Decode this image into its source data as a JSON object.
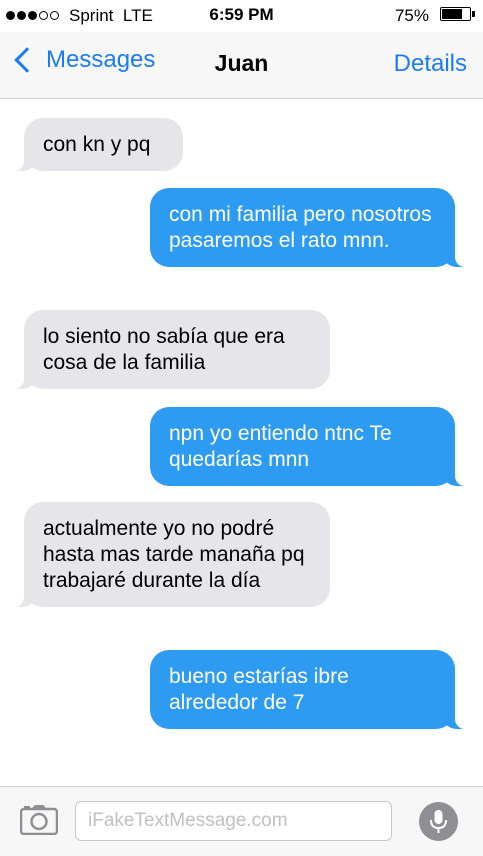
{
  "status_bar": {
    "signal_filled": 3,
    "signal_total": 5,
    "carrier": "Sprint",
    "network": "LTE",
    "time": "6:59 PM",
    "battery_text": "75%",
    "battery_level": 0.75
  },
  "nav": {
    "back_label": "Messages",
    "title": "Juan",
    "details_label": "Details"
  },
  "messages": [
    {
      "direction": "incoming",
      "text": "con kn y pq"
    },
    {
      "direction": "outgoing",
      "text": "con mi familia pero nosotros pasaremos el rato mnn."
    },
    {
      "direction": "incoming",
      "text": "lo siento no sabía que era cosa de la familia"
    },
    {
      "direction": "outgoing",
      "text": "npn yo entiendo ntnc Te quedarías mnn"
    },
    {
      "direction": "incoming",
      "text": "actualmente yo no podré hasta mas tarde manaña pq trabajaré durante la día"
    },
    {
      "direction": "outgoing",
      "text": "bueno estarías ibre alrededor de 7"
    }
  ],
  "input_bar": {
    "camera_icon": "camera-icon",
    "placeholder": "iFakeTextMessage.com",
    "value": "",
    "mic_icon": "microphone-icon"
  },
  "colors": {
    "accent": "#1a7cf5",
    "outgoing_bubble": "#2e9bf2",
    "incoming_bubble": "#e5e5ea"
  }
}
